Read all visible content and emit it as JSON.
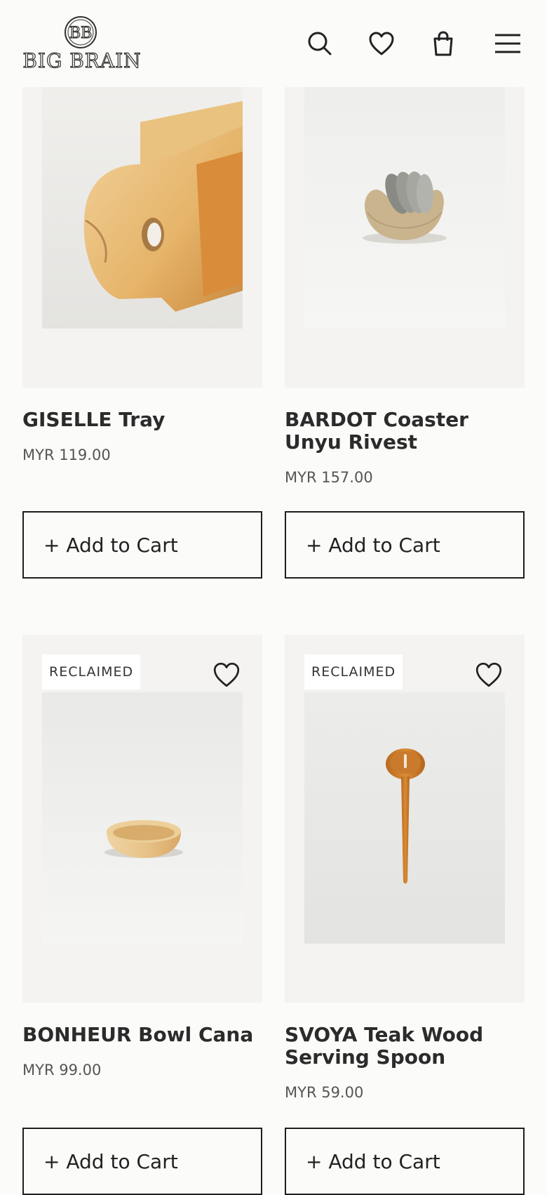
{
  "header": {
    "brand_name": "BIG BRAIN",
    "icons": [
      "search-icon",
      "heart-icon",
      "shopping-bag-icon",
      "menu-icon"
    ]
  },
  "products": [
    {
      "title": "GISELLE Tray",
      "price": "MYR 119.00",
      "badge": "",
      "cart_label": "+ Add to Cart"
    },
    {
      "title": "BARDOT Coaster Unyu Rivest",
      "price": "MYR 157.00",
      "badge": "",
      "cart_label": "+ Add to Cart"
    },
    {
      "title": "BONHEUR Bowl Cana",
      "price": "MYR 99.00",
      "badge": "RECLAIMED",
      "cart_label": "+ Add to Cart"
    },
    {
      "title": "SVOYA Teak Wood Serving Spoon",
      "price": "MYR 59.00",
      "badge": "RECLAIMED",
      "cart_label": "+ Add to Cart"
    }
  ],
  "colors": {
    "background": "#fbfbf9",
    "card_background": "#f4f3f1",
    "text": "#2b2b2b",
    "border": "#1e1e1e"
  }
}
